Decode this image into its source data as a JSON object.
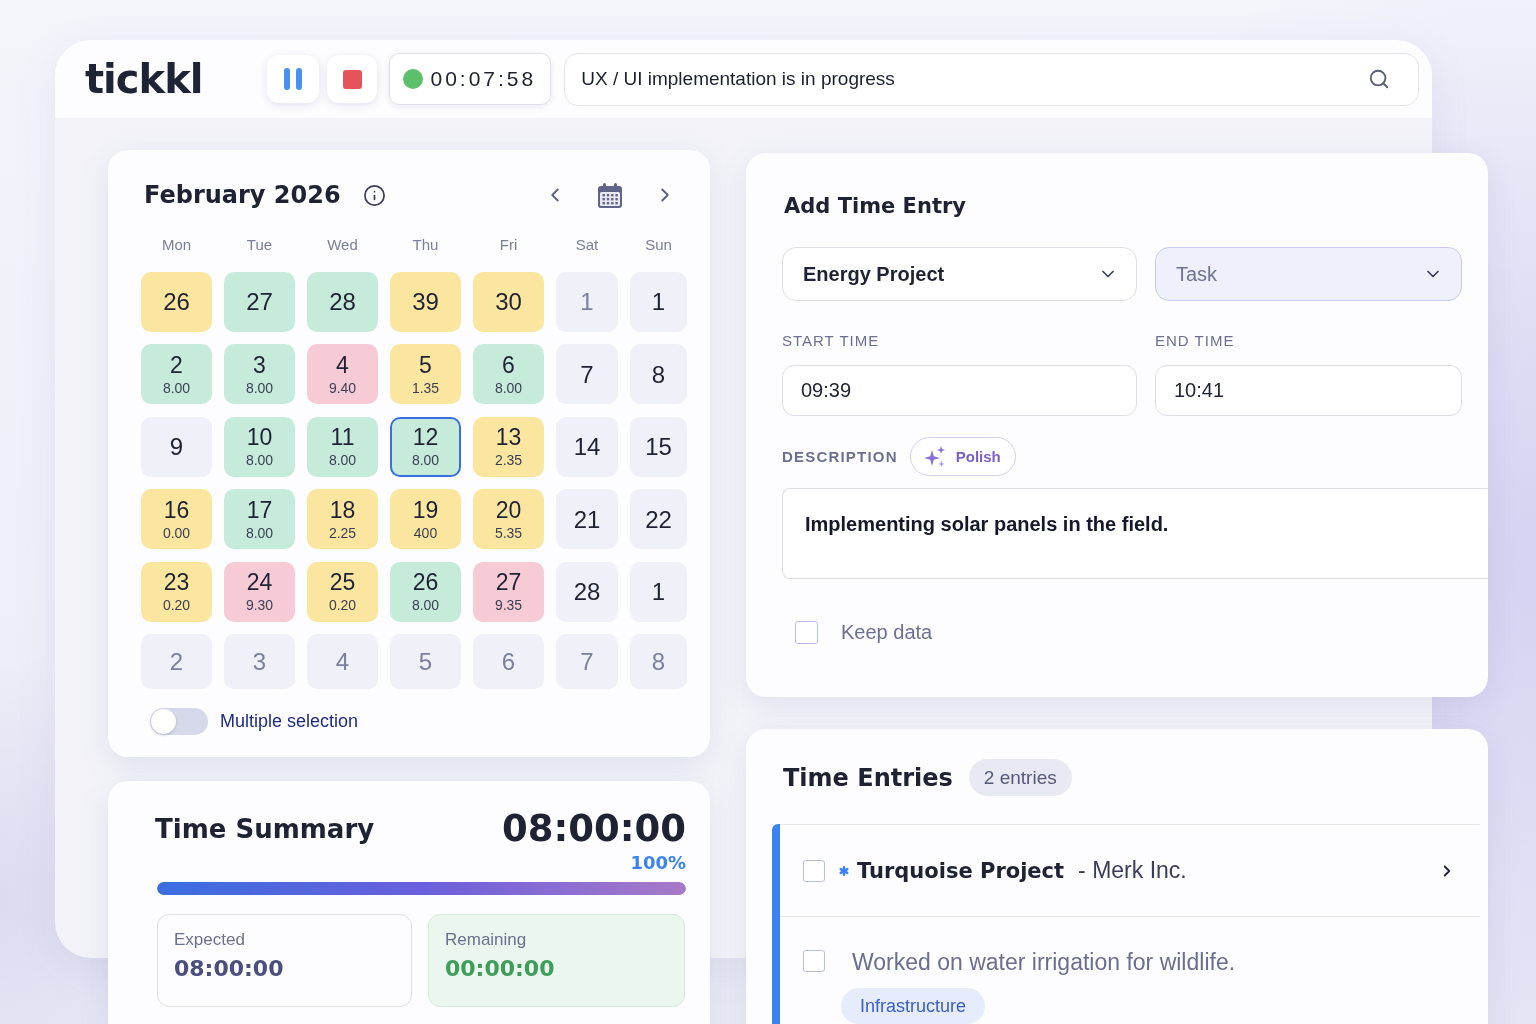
{
  "header": {
    "logo": "tickkl",
    "timer": {
      "time": "00:07:58",
      "running": true
    },
    "search": {
      "value": "UX / UI implementation is in progress"
    }
  },
  "calendar": {
    "title": "February 2026",
    "weekdays": [
      "Mon",
      "Tue",
      "Wed",
      "Thu",
      "Fri",
      "Sat",
      "Sun"
    ],
    "days": [
      {
        "day": "26",
        "color": "#fbe6a0",
        "selected": false,
        "muted": false
      },
      {
        "day": "27",
        "color": "#c7ebdb",
        "selected": false,
        "muted": false
      },
      {
        "day": "28",
        "color": "#c7ebdb",
        "selected": false,
        "muted": false
      },
      {
        "day": "39",
        "color": "#fbe6a0",
        "selected": false,
        "muted": false
      },
      {
        "day": "30",
        "color": "#fbe6a0",
        "selected": false,
        "muted": false
      },
      {
        "day": "1",
        "color": "#eff0f8",
        "selected": false,
        "muted": true
      },
      {
        "day": "1",
        "color": "#eff0f8",
        "selected": false,
        "muted": false
      },
      {
        "day": "2",
        "hours": "8.00",
        "color": "#c7ebdb",
        "selected": false,
        "muted": false
      },
      {
        "day": "3",
        "hours": "8.00",
        "color": "#c7ebdb",
        "selected": false,
        "muted": false
      },
      {
        "day": "4",
        "hours": "9.40",
        "color": "#f7cbd5",
        "selected": false,
        "muted": false
      },
      {
        "day": "5",
        "hours": "1.35",
        "color": "#fbe6a0",
        "selected": false,
        "muted": false
      },
      {
        "day": "6",
        "hours": "8.00",
        "color": "#c7ebdb",
        "selected": false,
        "muted": false
      },
      {
        "day": "7",
        "color": "#eff0f8",
        "selected": false,
        "muted": false
      },
      {
        "day": "8",
        "color": "#eff0f8",
        "selected": false,
        "muted": false
      },
      {
        "day": "9",
        "color": "#eff0f8",
        "selected": false,
        "muted": false
      },
      {
        "day": "10",
        "hours": "8.00",
        "color": "#c7ebdb",
        "selected": false,
        "muted": false
      },
      {
        "day": "11",
        "hours": "8.00",
        "color": "#c7ebdb",
        "selected": false,
        "muted": false
      },
      {
        "day": "12",
        "hours": "8.00",
        "color": "#c7ebdb",
        "selected": true,
        "muted": false
      },
      {
        "day": "13",
        "hours": "2.35",
        "color": "#fbe6a0",
        "selected": false,
        "muted": false
      },
      {
        "day": "14",
        "color": "#eff0f8",
        "selected": false,
        "muted": false
      },
      {
        "day": "15",
        "color": "#eff0f8",
        "selected": false,
        "muted": false
      },
      {
        "day": "16",
        "hours": "0.00",
        "color": "#fbe6a0",
        "selected": false,
        "muted": false
      },
      {
        "day": "17",
        "hours": "8.00",
        "color": "#c7ebdb",
        "selected": false,
        "muted": false
      },
      {
        "day": "18",
        "hours": "2.25",
        "color": "#fbe6a0",
        "selected": false,
        "muted": false
      },
      {
        "day": "19",
        "hours": "400",
        "color": "#fbe6a0",
        "selected": false,
        "muted": false
      },
      {
        "day": "20",
        "hours": "5.35",
        "color": "#fbe6a0",
        "selected": false,
        "muted": false
      },
      {
        "day": "21",
        "color": "#eff0f8",
        "selected": false,
        "muted": false
      },
      {
        "day": "22",
        "color": "#eff0f8",
        "selected": false,
        "muted": false
      },
      {
        "day": "23",
        "hours": "0.20",
        "color": "#fbe6a0",
        "selected": false,
        "muted": false
      },
      {
        "day": "24",
        "hours": "9.30",
        "color": "#f7cbd5",
        "selected": false,
        "muted": false
      },
      {
        "day": "25",
        "hours": "0.20",
        "color": "#fbe6a0",
        "selected": false,
        "muted": false
      },
      {
        "day": "26",
        "hours": "8.00",
        "color": "#c7ebdb",
        "selected": false,
        "muted": false
      },
      {
        "day": "27",
        "hours": "9.35",
        "color": "#f7cbd5",
        "selected": false,
        "muted": false
      },
      {
        "day": "28",
        "color": "#eff0f8",
        "selected": false,
        "muted": false
      },
      {
        "day": "1",
        "color": "#eff0f8",
        "selected": false,
        "muted": false
      },
      {
        "day": "2",
        "color": "#eff0f8",
        "selected": false,
        "muted": true
      },
      {
        "day": "3",
        "color": "#eff0f8",
        "selected": false,
        "muted": true
      },
      {
        "day": "4",
        "color": "#eff0f8",
        "selected": false,
        "muted": true
      },
      {
        "day": "5",
        "color": "#eff0f8",
        "selected": false,
        "muted": true
      },
      {
        "day": "6",
        "color": "#eff0f8",
        "selected": false,
        "muted": true
      },
      {
        "day": "7",
        "color": "#eff0f8",
        "selected": false,
        "muted": true
      },
      {
        "day": "8",
        "color": "#eff0f8",
        "selected": false,
        "muted": true
      }
    ],
    "multiple_selection": {
      "label": "Multiple selection",
      "on": false
    }
  },
  "time_summary": {
    "title": "Time Summary",
    "total": "08:00:00",
    "percent": "100%",
    "level": 1,
    "expected": {
      "label": "Expected",
      "value": "08:00:00"
    },
    "remaining": {
      "label": "Remaining",
      "value": "00:00:00"
    }
  },
  "add_time_entry": {
    "title": "Add Time Entry",
    "project_select": {
      "value": "Energy Project",
      "focused": false
    },
    "task_select": {
      "placeholder": "Task",
      "focused": true
    },
    "start_time": {
      "label": "START TIME",
      "value": "09:39"
    },
    "end_time": {
      "label": "END TIME",
      "value": "10:41"
    },
    "description": {
      "label": "DESCRIPTION",
      "polish_button": "Polish",
      "value": "Implementing solar panels in the field."
    },
    "keep_data": {
      "label": "Keep data",
      "checked": false
    }
  },
  "time_entries": {
    "title": "Time Entries",
    "count": "2 entries",
    "groups": [
      {
        "color": "#3b82f6",
        "project": "Turquoise Project",
        "client": "- Merk Inc.",
        "checked": false,
        "entries": [
          {
            "description": "Worked on water irrigation for wildlife.",
            "checked": false,
            "tags": [
              "Infrastructure"
            ]
          }
        ]
      }
    ]
  }
}
